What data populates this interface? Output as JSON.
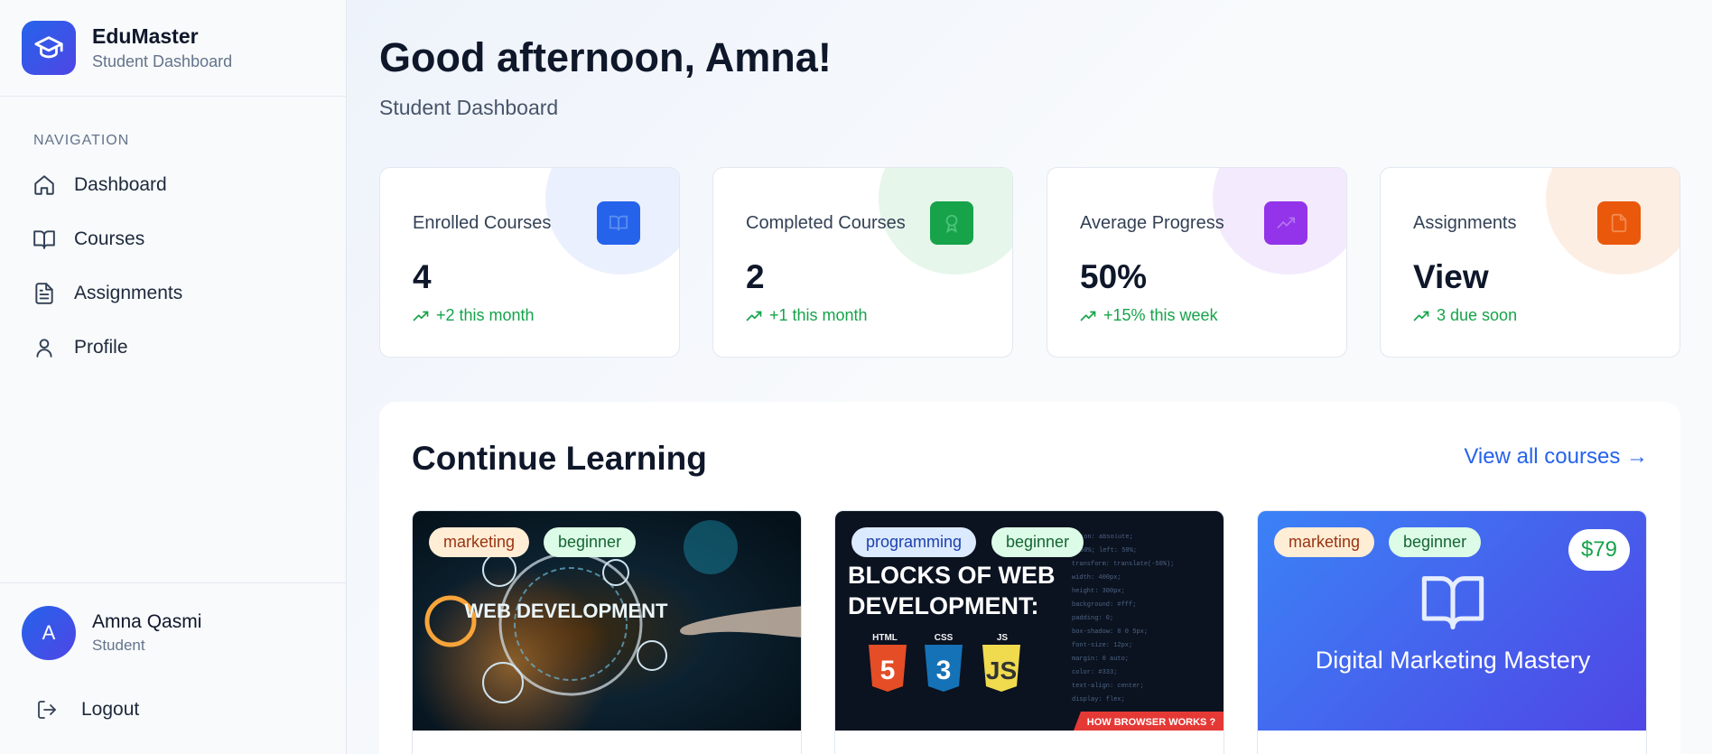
{
  "brand": {
    "name": "EduMaster",
    "subtitle": "Student Dashboard"
  },
  "nav": {
    "heading": "NAVIGATION",
    "items": [
      {
        "label": "Dashboard",
        "icon": "home-icon"
      },
      {
        "label": "Courses",
        "icon": "book-open-icon"
      },
      {
        "label": "Assignments",
        "icon": "document-icon"
      },
      {
        "label": "Profile",
        "icon": "user-icon"
      }
    ]
  },
  "user": {
    "initial": "A",
    "name": "Amna Qasmi",
    "role": "Student"
  },
  "logout_label": "Logout",
  "header": {
    "greeting": "Good afternoon, Amna!",
    "subtitle": "Student Dashboard"
  },
  "stats": [
    {
      "label": "Enrolled Courses",
      "value": "4",
      "trend": "+2 this month",
      "icon": "book-icon",
      "color": "#2563eb",
      "blob": "#eaf0fe"
    },
    {
      "label": "Completed Courses",
      "value": "2",
      "trend": "+1 this month",
      "icon": "award-icon",
      "color": "#16a34a",
      "blob": "#e6f6eb"
    },
    {
      "label": "Average Progress",
      "value": "50%",
      "trend": "+15% this week",
      "icon": "trending-up-icon",
      "color": "#9333ea",
      "blob": "#f3eafd"
    },
    {
      "label": "Assignments",
      "value": "View",
      "trend": "3 due soon",
      "icon": "document-icon",
      "color": "#ea580c",
      "blob": "#fdeee4"
    }
  ],
  "continue": {
    "title": "Continue Learning",
    "view_all": "View all courses →",
    "courses": [
      {
        "category": "marketing",
        "level": "beginner",
        "image_text": "WEB DEVELOPMENT"
      },
      {
        "category": "programming",
        "level": "beginner",
        "image_text_lines": [
          "BLOCKS OF WEB",
          "DEVELOPMENT:"
        ],
        "image_badges": [
          "HTML",
          "CSS",
          "JS"
        ],
        "image_caption": "HOW BROWSER WORKS ?"
      },
      {
        "category": "marketing",
        "level": "beginner",
        "price": "$79",
        "title": "Digital Marketing Mastery"
      }
    ]
  },
  "colors": {
    "accent": "#2563eb",
    "success": "#16a34a"
  }
}
